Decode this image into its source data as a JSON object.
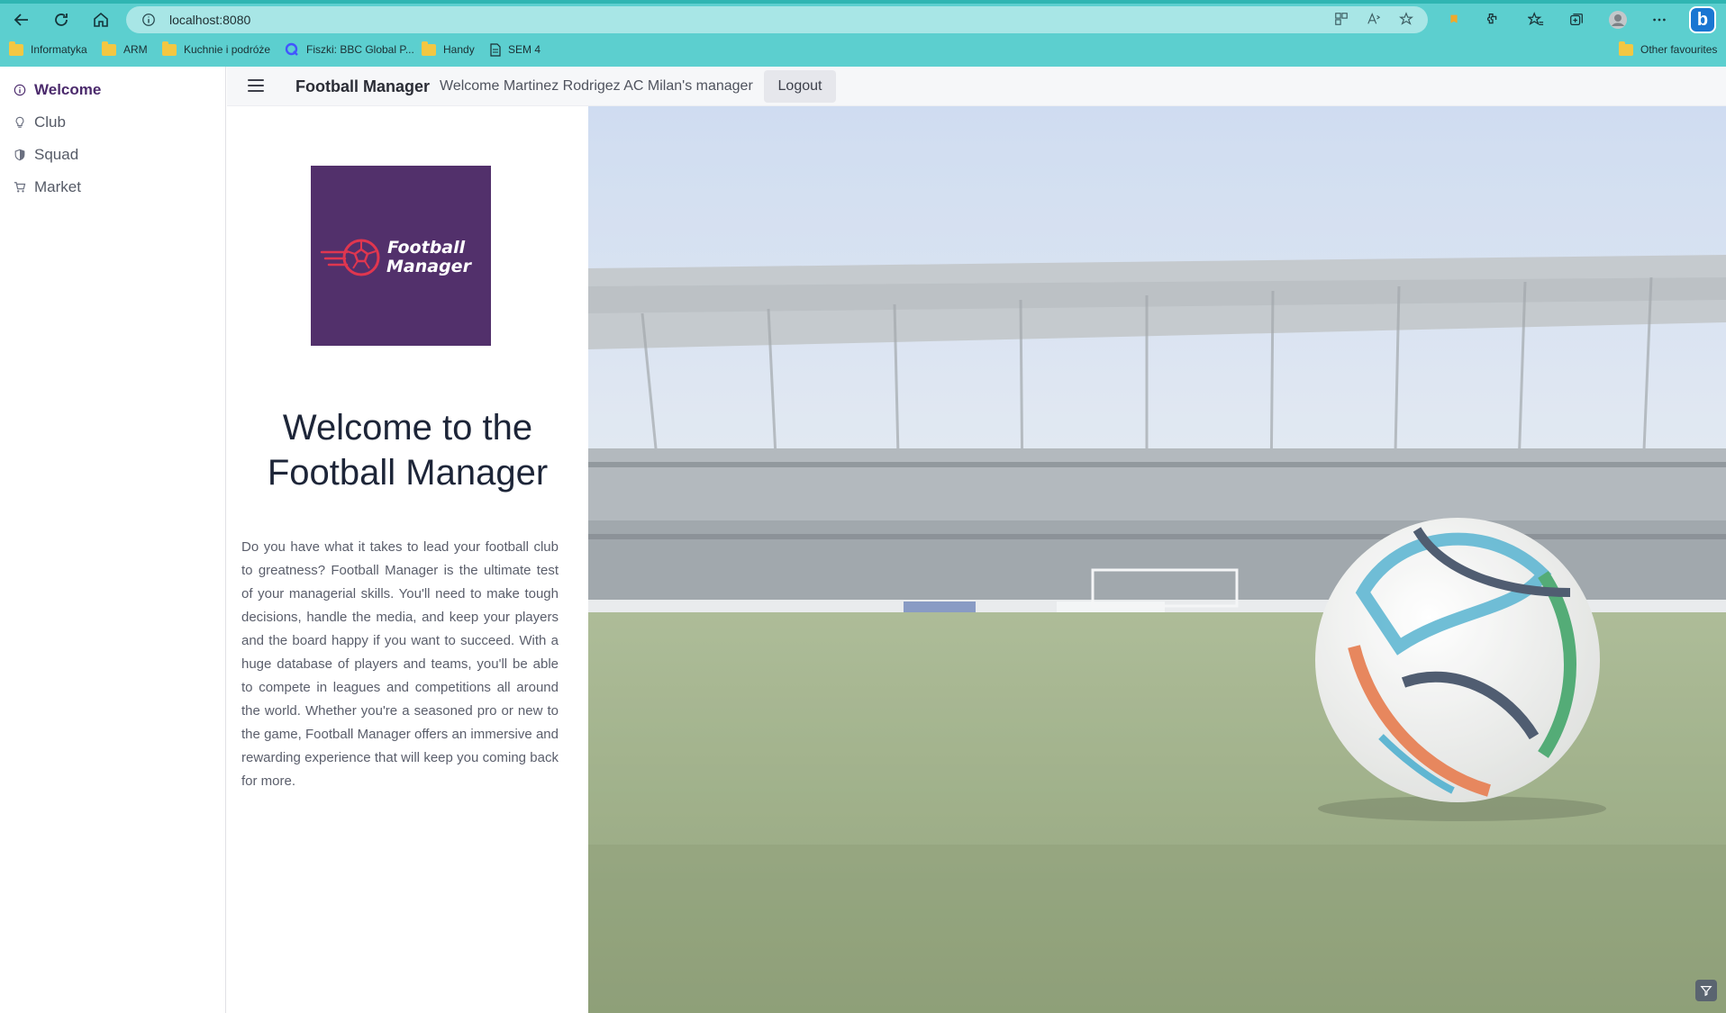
{
  "browser": {
    "url": "localhost:8080",
    "bookmarks": [
      {
        "label": "Informatyka",
        "icon": "folder-icon"
      },
      {
        "label": "ARM",
        "icon": "folder-icon"
      },
      {
        "label": "Kuchnie i podróże",
        "icon": "folder-icon"
      },
      {
        "label": "Fiszki: BBC Global P...",
        "icon": "quizlet-icon"
      },
      {
        "label": "Handy",
        "icon": "folder-icon"
      },
      {
        "label": "SEM 4",
        "icon": "page-icon"
      }
    ],
    "other_favourites": "Other favourites"
  },
  "sidebar": {
    "items": [
      {
        "label": "Welcome",
        "icon": "info-icon",
        "active": true
      },
      {
        "label": "Club",
        "icon": "lightbulb-icon",
        "active": false
      },
      {
        "label": "Squad",
        "icon": "shield-icon",
        "active": false
      },
      {
        "label": "Market",
        "icon": "cart-icon",
        "active": false
      }
    ]
  },
  "header": {
    "title": "Football Manager",
    "welcome": "Welcome Martinez Rodrigez AC Milan's manager",
    "logout_label": "Logout"
  },
  "main": {
    "logo_line1": "Football",
    "logo_line2": "Manager",
    "heading": "Welcome to the Football Manager",
    "description": "Do you have what it takes to lead your football club to greatness? Football Manager is the ultimate test of your managerial skills. You'll need to make tough decisions, handle the media, and keep your players and the board happy if you want to succeed. With a huge database of players and teams, you'll be able to compete in leagues and competitions all around the world. Whether you're a seasoned pro or new to the game, Football Manager offers an immersive and rewarding experience that will keep you coming back for more."
  },
  "colors": {
    "browser_chrome": "#5ccfcf",
    "logo_bg": "#52306b",
    "active_nav": "#4b2a6c"
  }
}
